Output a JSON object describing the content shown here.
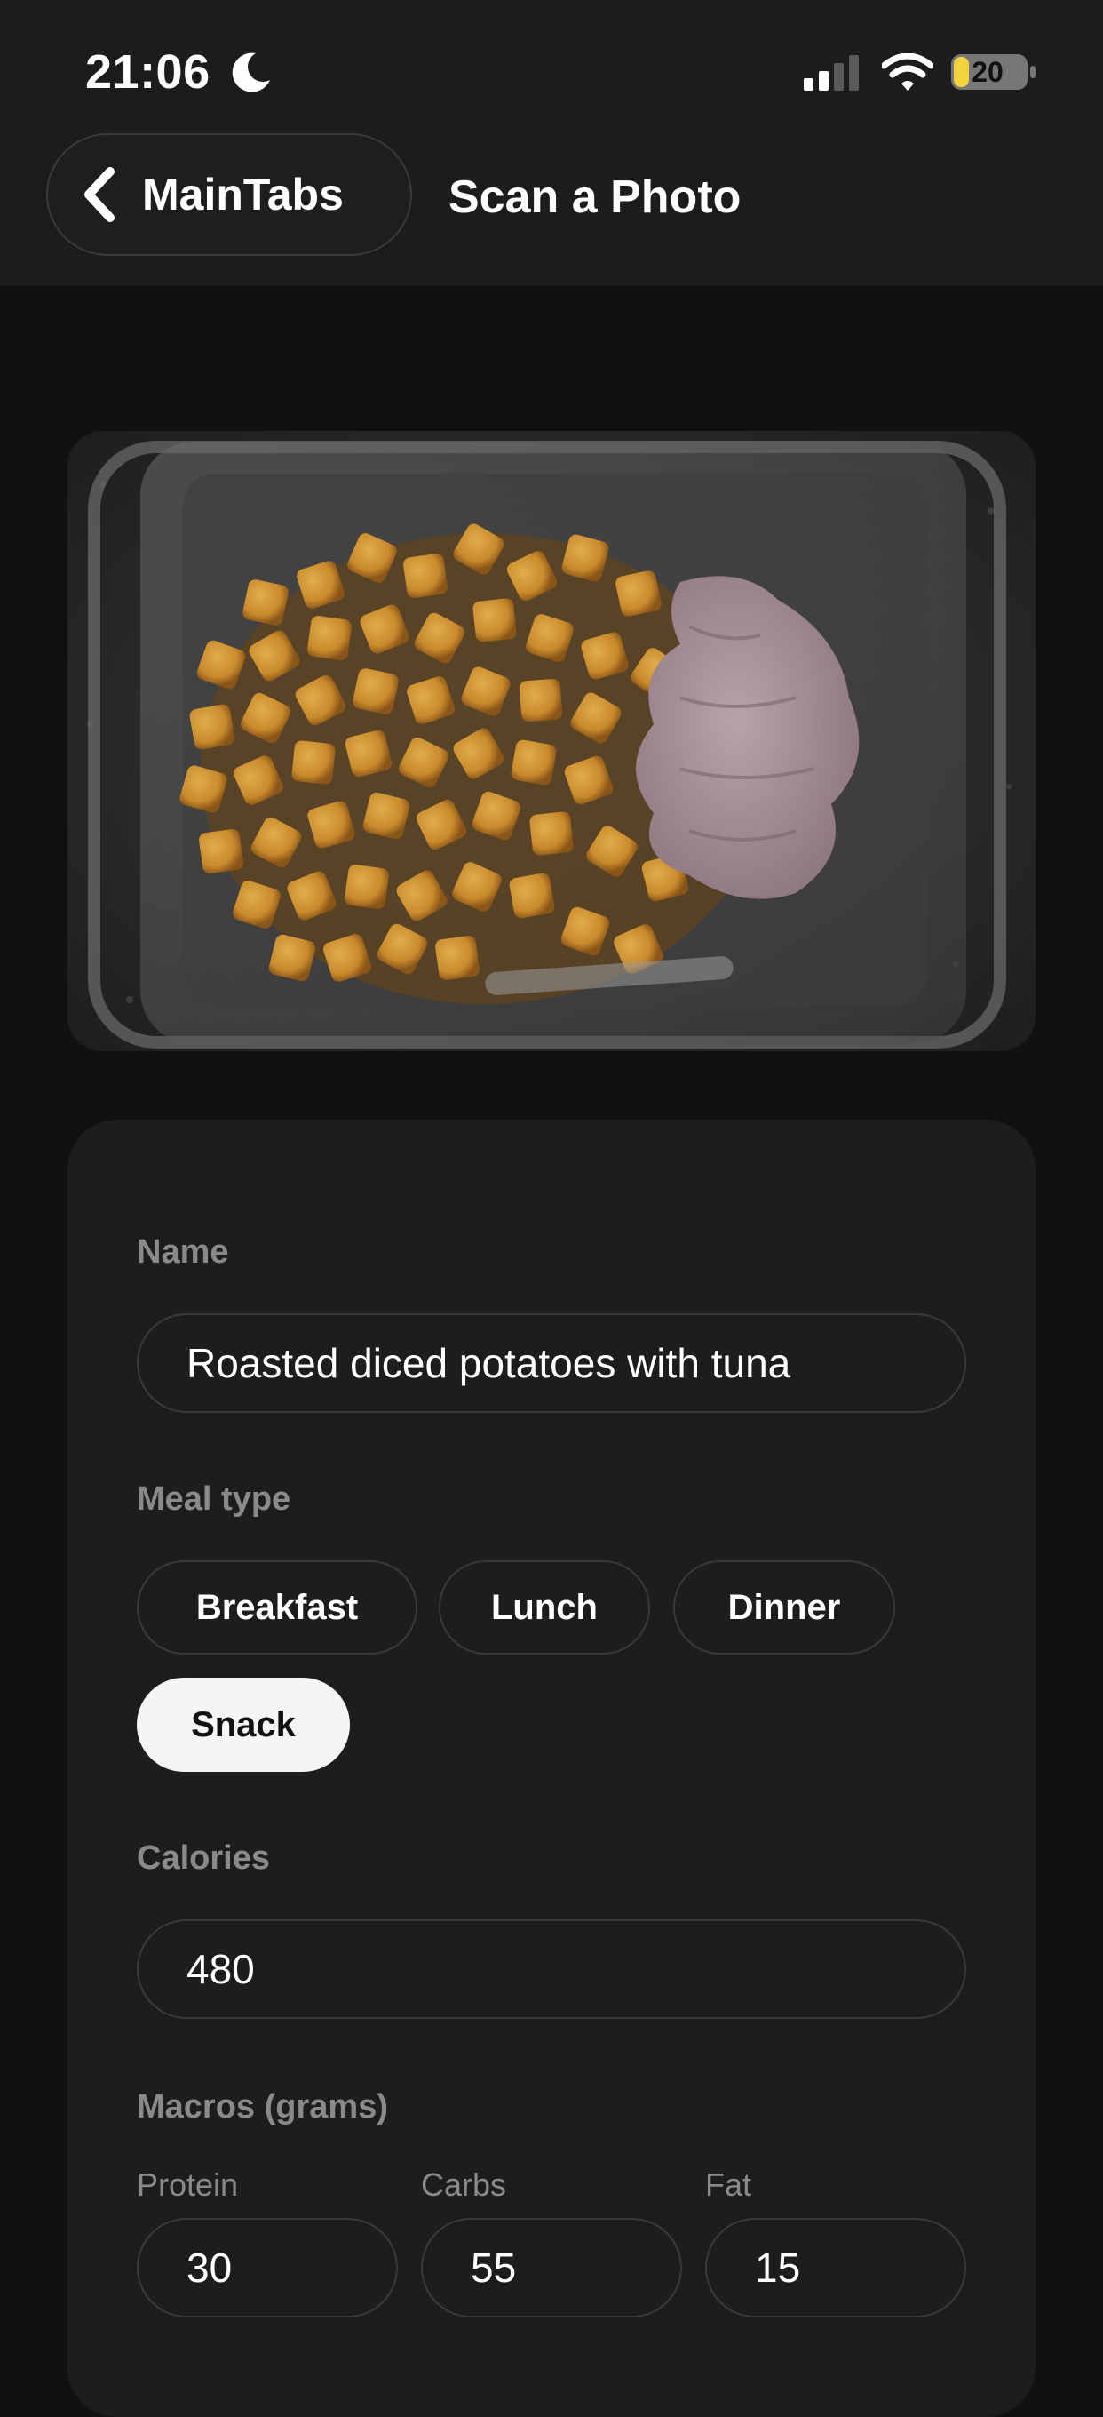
{
  "status_bar": {
    "time": "21:06",
    "battery": "20",
    "icons": [
      "moon-icon",
      "signal-icon",
      "wifi-icon",
      "battery-icon"
    ]
  },
  "nav": {
    "back_label": "MainTabs",
    "title": "Scan a Photo",
    "back_icon": "chevron-left-icon"
  },
  "form": {
    "name_label": "Name",
    "name_value": "Roasted diced potatoes with tuna",
    "meal_type_label": "Meal type",
    "meal_types": [
      "Breakfast",
      "Lunch",
      "Dinner",
      "Snack"
    ],
    "selected_meal_type": "Snack",
    "calories_label": "Calories",
    "calories_value": "480",
    "macros_label": "Macros (grams)",
    "macros": [
      {
        "label": "Protein",
        "value": "30"
      },
      {
        "label": "Carbs",
        "value": "55"
      },
      {
        "label": "Fat",
        "value": "15"
      }
    ]
  },
  "colors": {
    "background": "#111111",
    "card": "#1d1d1d",
    "label_gray": "#8a8a8a",
    "selected_chip": "#f5f5f5",
    "battery_yellow": "#f2d33b"
  }
}
